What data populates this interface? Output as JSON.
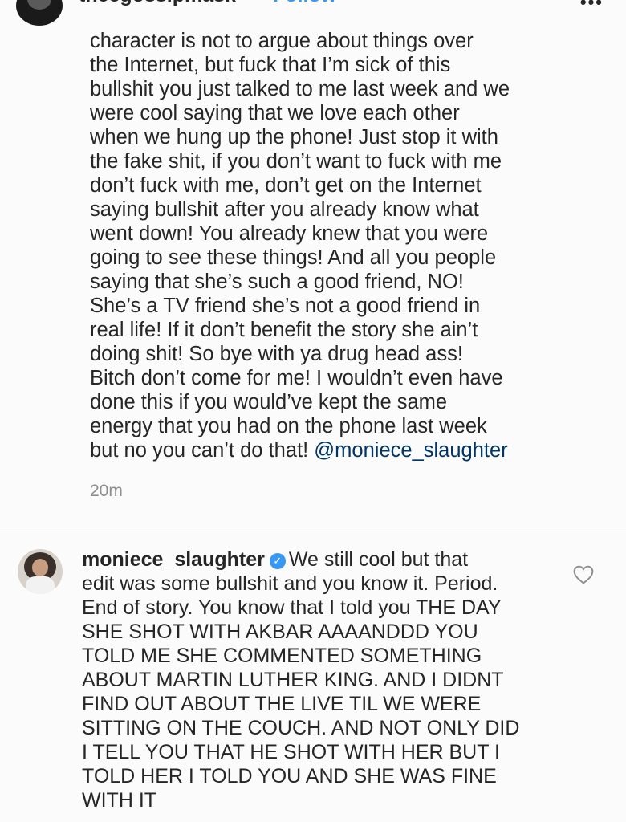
{
  "header": {
    "username": "theegossipmask",
    "separator": "•",
    "follow_label": "Follow",
    "more_icon": "more-options-icon"
  },
  "post": {
    "caption_lines": [
      "character is not to argue about things over",
      "the Internet, but fuck that I’m sick of this",
      "bullshit you just talked to me last week and we",
      "were cool saying that we love each other",
      "when we hung up the phone! Just stop it with",
      "the fake shit, if you don’t want to fuck with me",
      "don’t fuck with me, don’t get on the Internet",
      "saying bullshit after you already know what",
      "went down! You already knew that you were",
      "going to see these things! And all you people",
      "saying that she’s such a good friend, NO!",
      "She’s a TV friend she’s not a good friend in",
      "real life! If it don’t benefit the story she ain’t",
      "doing shit! So bye with ya drug head ass!",
      "Bitch don’t come for me! I wouldn’t even have",
      "done this if you would’ve kept the same",
      "energy that you had on the phone last week",
      "but no you can’t do that!"
    ],
    "mention": "@moniece_slaughter",
    "timestamp": "20m"
  },
  "comment": {
    "username": "moniece_slaughter",
    "verified": true,
    "first_line_text": "We still cool but that",
    "lines": [
      "edit was some bullshit and you know it. Period.",
      "End of story. You know that I told you THE DAY",
      "SHE SHOT WITH AKBAR AAAANDDD YOU",
      "TOLD ME SHE COMMENTED SOMETHING",
      "ABOUT MARTIN LUTHER KING. AND I DIDNT",
      "FIND OUT ABOUT THE LIVE TIL WE WERE",
      "SITTING ON THE COUCH. AND NOT ONLY DID",
      "I TELL YOU THAT HE SHOT WITH HER BUT I",
      "TOLD HER I TOLD YOU AND SHE WAS FINE",
      "WITH IT"
    ],
    "like_icon": "heart-icon"
  },
  "colors": {
    "text": "#262626",
    "link": "#3897f0",
    "mention": "#003569",
    "muted": "#8e8e8e",
    "divider": "#dbdbdb"
  }
}
